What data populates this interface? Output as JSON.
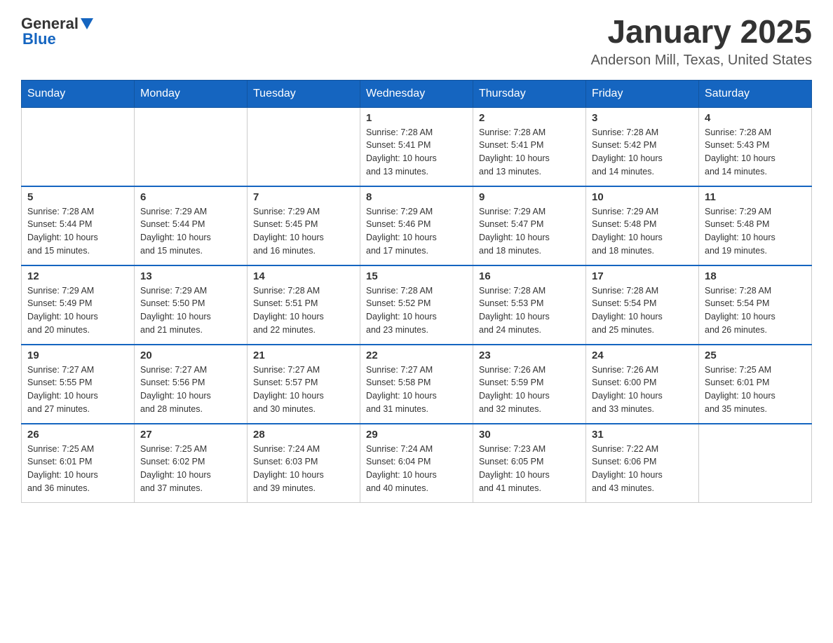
{
  "logo": {
    "text_general": "General",
    "text_blue": "Blue"
  },
  "header": {
    "title": "January 2025",
    "subtitle": "Anderson Mill, Texas, United States"
  },
  "days_of_week": [
    "Sunday",
    "Monday",
    "Tuesday",
    "Wednesday",
    "Thursday",
    "Friday",
    "Saturday"
  ],
  "weeks": [
    [
      {
        "day": "",
        "info": ""
      },
      {
        "day": "",
        "info": ""
      },
      {
        "day": "",
        "info": ""
      },
      {
        "day": "1",
        "info": "Sunrise: 7:28 AM\nSunset: 5:41 PM\nDaylight: 10 hours\nand 13 minutes."
      },
      {
        "day": "2",
        "info": "Sunrise: 7:28 AM\nSunset: 5:41 PM\nDaylight: 10 hours\nand 13 minutes."
      },
      {
        "day": "3",
        "info": "Sunrise: 7:28 AM\nSunset: 5:42 PM\nDaylight: 10 hours\nand 14 minutes."
      },
      {
        "day": "4",
        "info": "Sunrise: 7:28 AM\nSunset: 5:43 PM\nDaylight: 10 hours\nand 14 minutes."
      }
    ],
    [
      {
        "day": "5",
        "info": "Sunrise: 7:28 AM\nSunset: 5:44 PM\nDaylight: 10 hours\nand 15 minutes."
      },
      {
        "day": "6",
        "info": "Sunrise: 7:29 AM\nSunset: 5:44 PM\nDaylight: 10 hours\nand 15 minutes."
      },
      {
        "day": "7",
        "info": "Sunrise: 7:29 AM\nSunset: 5:45 PM\nDaylight: 10 hours\nand 16 minutes."
      },
      {
        "day": "8",
        "info": "Sunrise: 7:29 AM\nSunset: 5:46 PM\nDaylight: 10 hours\nand 17 minutes."
      },
      {
        "day": "9",
        "info": "Sunrise: 7:29 AM\nSunset: 5:47 PM\nDaylight: 10 hours\nand 18 minutes."
      },
      {
        "day": "10",
        "info": "Sunrise: 7:29 AM\nSunset: 5:48 PM\nDaylight: 10 hours\nand 18 minutes."
      },
      {
        "day": "11",
        "info": "Sunrise: 7:29 AM\nSunset: 5:48 PM\nDaylight: 10 hours\nand 19 minutes."
      }
    ],
    [
      {
        "day": "12",
        "info": "Sunrise: 7:29 AM\nSunset: 5:49 PM\nDaylight: 10 hours\nand 20 minutes."
      },
      {
        "day": "13",
        "info": "Sunrise: 7:29 AM\nSunset: 5:50 PM\nDaylight: 10 hours\nand 21 minutes."
      },
      {
        "day": "14",
        "info": "Sunrise: 7:28 AM\nSunset: 5:51 PM\nDaylight: 10 hours\nand 22 minutes."
      },
      {
        "day": "15",
        "info": "Sunrise: 7:28 AM\nSunset: 5:52 PM\nDaylight: 10 hours\nand 23 minutes."
      },
      {
        "day": "16",
        "info": "Sunrise: 7:28 AM\nSunset: 5:53 PM\nDaylight: 10 hours\nand 24 minutes."
      },
      {
        "day": "17",
        "info": "Sunrise: 7:28 AM\nSunset: 5:54 PM\nDaylight: 10 hours\nand 25 minutes."
      },
      {
        "day": "18",
        "info": "Sunrise: 7:28 AM\nSunset: 5:54 PM\nDaylight: 10 hours\nand 26 minutes."
      }
    ],
    [
      {
        "day": "19",
        "info": "Sunrise: 7:27 AM\nSunset: 5:55 PM\nDaylight: 10 hours\nand 27 minutes."
      },
      {
        "day": "20",
        "info": "Sunrise: 7:27 AM\nSunset: 5:56 PM\nDaylight: 10 hours\nand 28 minutes."
      },
      {
        "day": "21",
        "info": "Sunrise: 7:27 AM\nSunset: 5:57 PM\nDaylight: 10 hours\nand 30 minutes."
      },
      {
        "day": "22",
        "info": "Sunrise: 7:27 AM\nSunset: 5:58 PM\nDaylight: 10 hours\nand 31 minutes."
      },
      {
        "day": "23",
        "info": "Sunrise: 7:26 AM\nSunset: 5:59 PM\nDaylight: 10 hours\nand 32 minutes."
      },
      {
        "day": "24",
        "info": "Sunrise: 7:26 AM\nSunset: 6:00 PM\nDaylight: 10 hours\nand 33 minutes."
      },
      {
        "day": "25",
        "info": "Sunrise: 7:25 AM\nSunset: 6:01 PM\nDaylight: 10 hours\nand 35 minutes."
      }
    ],
    [
      {
        "day": "26",
        "info": "Sunrise: 7:25 AM\nSunset: 6:01 PM\nDaylight: 10 hours\nand 36 minutes."
      },
      {
        "day": "27",
        "info": "Sunrise: 7:25 AM\nSunset: 6:02 PM\nDaylight: 10 hours\nand 37 minutes."
      },
      {
        "day": "28",
        "info": "Sunrise: 7:24 AM\nSunset: 6:03 PM\nDaylight: 10 hours\nand 39 minutes."
      },
      {
        "day": "29",
        "info": "Sunrise: 7:24 AM\nSunset: 6:04 PM\nDaylight: 10 hours\nand 40 minutes."
      },
      {
        "day": "30",
        "info": "Sunrise: 7:23 AM\nSunset: 6:05 PM\nDaylight: 10 hours\nand 41 minutes."
      },
      {
        "day": "31",
        "info": "Sunrise: 7:22 AM\nSunset: 6:06 PM\nDaylight: 10 hours\nand 43 minutes."
      },
      {
        "day": "",
        "info": ""
      }
    ]
  ]
}
